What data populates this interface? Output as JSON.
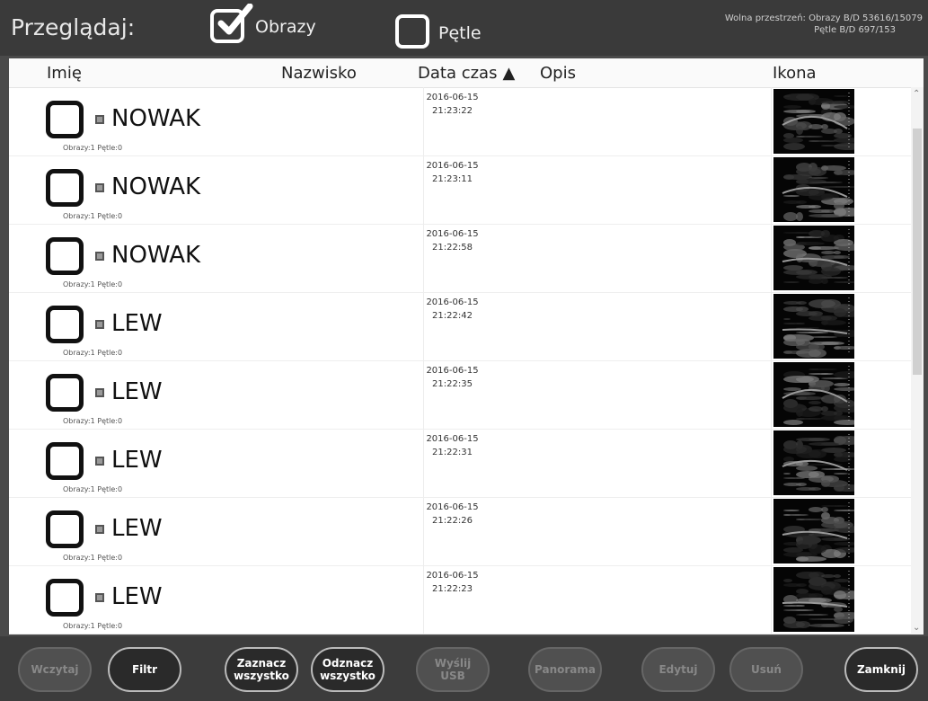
{
  "header": {
    "title": "Przeglądaj:",
    "images_label": "Obrazy",
    "images_checked": true,
    "loops_label": "Pętle",
    "loops_checked": false,
    "free_space_line1": "Wolna przestrzeń:  Obrazy B/D 53616/15079",
    "free_space_line2": "Pętle B/D 697/153"
  },
  "columns": {
    "first_name": "Imię",
    "last_name": "Nazwisko",
    "datetime": "Data czas",
    "description": "Opis",
    "icon": "Ikona"
  },
  "rows": [
    {
      "name": "NOWAK",
      "sub": "Obrazy:1 Pętle:0",
      "date": "2016-06-15",
      "time": "21:23:22"
    },
    {
      "name": "NOWAK",
      "sub": "Obrazy:1 Pętle:0",
      "date": "2016-06-15",
      "time": "21:23:11"
    },
    {
      "name": "NOWAK",
      "sub": "Obrazy:1 Pętle:0",
      "date": "2016-06-15",
      "time": "21:22:58"
    },
    {
      "name": "LEW",
      "sub": "Obrazy:1 Pętle:0",
      "date": "2016-06-15",
      "time": "21:22:42"
    },
    {
      "name": "LEW",
      "sub": "Obrazy:1 Pętle:0",
      "date": "2016-06-15",
      "time": "21:22:35"
    },
    {
      "name": "LEW",
      "sub": "Obrazy:1 Pętle:0",
      "date": "2016-06-15",
      "time": "21:22:31"
    },
    {
      "name": "LEW",
      "sub": "Obrazy:1 Pętle:0",
      "date": "2016-06-15",
      "time": "21:22:26"
    },
    {
      "name": "LEW",
      "sub": "Obrazy:1 Pętle:0",
      "date": "2016-06-15",
      "time": "21:22:23"
    }
  ],
  "buttons": {
    "load": "Wczytaj",
    "filter": "Filtr",
    "select_all_1": "Zaznacz",
    "select_all_2": "wszystko",
    "deselect_all_1": "Odznacz",
    "deselect_all_2": "wszystko",
    "send_usb_1": "Wyślij",
    "send_usb_2": "USB",
    "panorama": "Panorama",
    "edit": "Edytuj",
    "delete": "Usuń",
    "close": "Zamknij"
  },
  "icons": {
    "checkbox_checked": "check-icon",
    "sort": "sort-ascending-icon",
    "scroll_up": "chevron-up-icon",
    "scroll_down": "chevron-down-icon"
  }
}
